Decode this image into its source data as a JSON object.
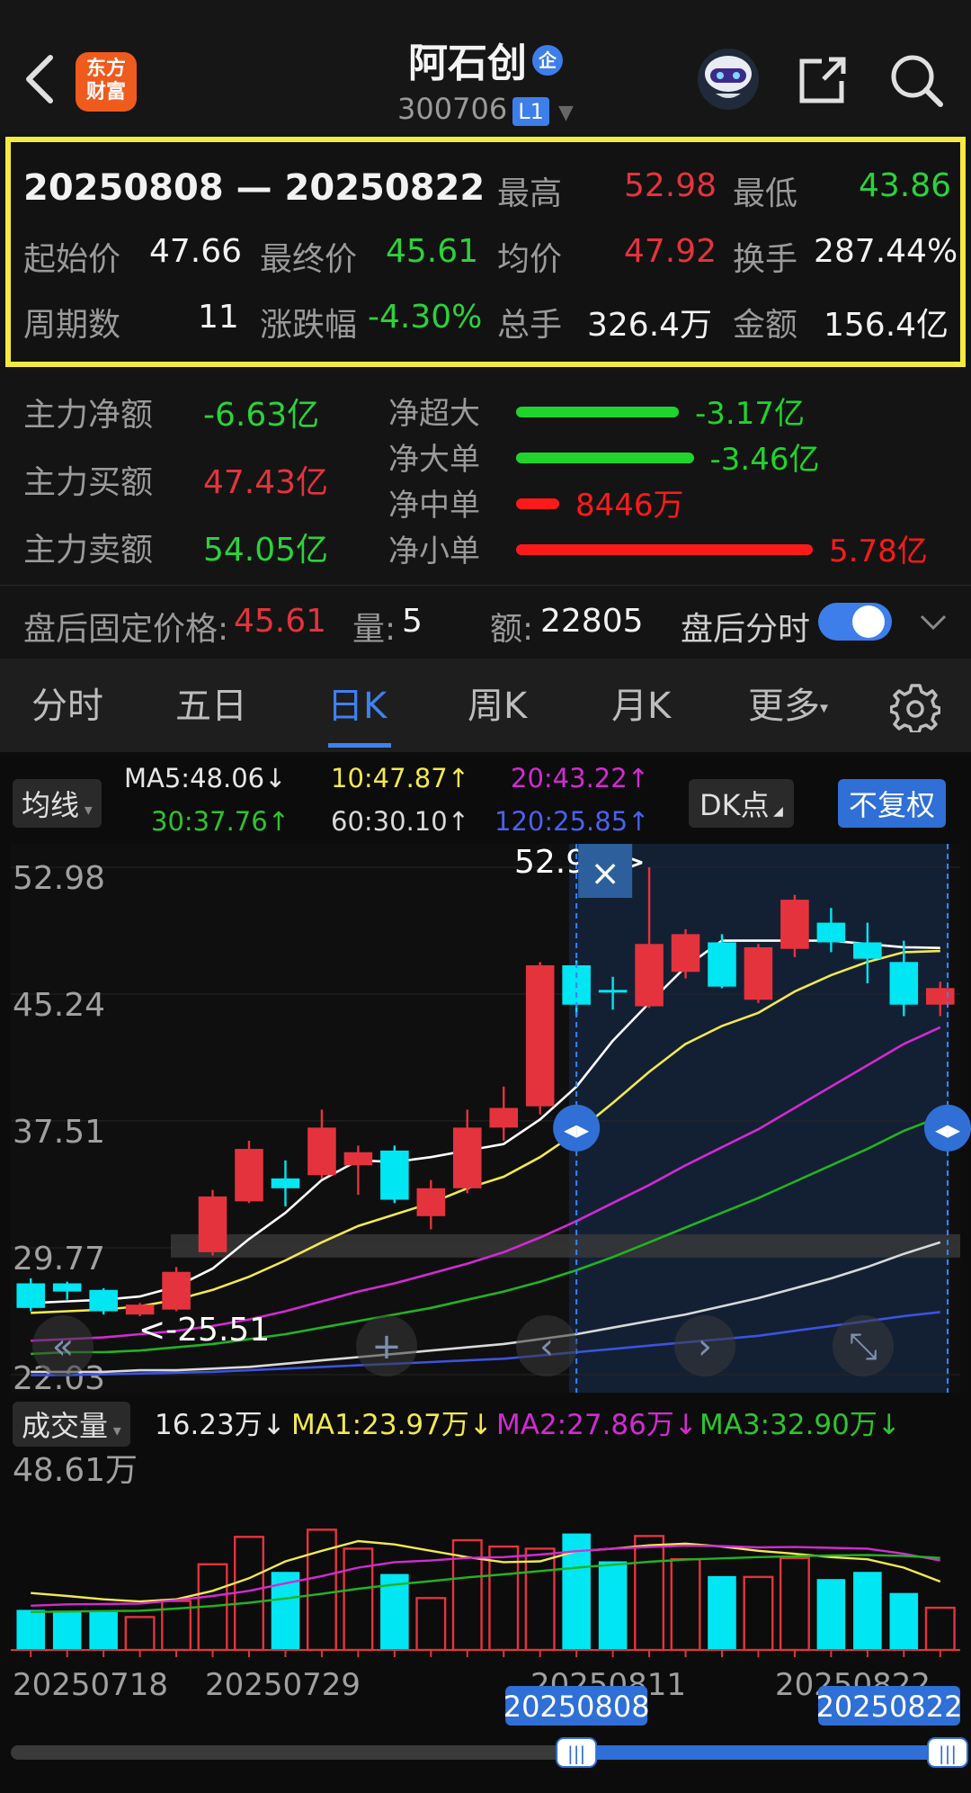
{
  "header": {
    "logo_line1": "东方",
    "logo_line2": "财富",
    "title": "阿石创",
    "title_badge": "企",
    "code": "300706",
    "level_badge": "L1"
  },
  "summary": {
    "range_start": "20250808",
    "range_sep": "—",
    "range_end": "20250822",
    "high_label": "最高",
    "high": "52.98",
    "low_label": "最低",
    "low": "43.86",
    "open_label": "起始价",
    "open": "47.66",
    "close_label": "最终价",
    "close": "45.61",
    "avg_label": "均价",
    "avg": "47.92",
    "turnover_label": "换手",
    "turnover": "287.44%",
    "periods_label": "周期数",
    "periods": "11",
    "change_label": "涨跌幅",
    "change": "-4.30%",
    "volume_label": "总手",
    "volume": "326.4万",
    "amount_label": "金额",
    "amount": "156.4亿"
  },
  "moneyflow": {
    "net_label": "主力净额",
    "net": "-6.63亿",
    "buy_label": "主力买额",
    "buy": "47.43亿",
    "sell_label": "主力卖额",
    "sell": "54.05亿",
    "rows": [
      {
        "label": "净超大",
        "value": "-3.17亿",
        "color": "#1fd42b",
        "magnitude": 3.17
      },
      {
        "label": "净大单",
        "value": "-3.46亿",
        "color": "#1fd42b",
        "magnitude": 3.46
      },
      {
        "label": "净中单",
        "value": "8446万",
        "color": "#ff1a1a",
        "magnitude": 0.84
      },
      {
        "label": "净小单",
        "value": "5.78亿",
        "color": "#ff1a1a",
        "magnitude": 5.78
      }
    ]
  },
  "afterhours": {
    "price_label": "盘后固定价格:",
    "price": "45.61",
    "qty_label": "量:",
    "qty": "5",
    "amt_label": "额:",
    "amt": "22805",
    "toggle_label": "盘后分时"
  },
  "tabs": [
    "分时",
    "五日",
    "日K",
    "周K",
    "月K",
    "更多"
  ],
  "active_tab": "日K",
  "ma_bar": {
    "select_label": "均线",
    "ma5": "MA5:48.06↓",
    "ma10": "10:47.87↑",
    "ma20": "20:43.22↑",
    "ma30": "30:37.76↑",
    "ma60": "60:30.10↑",
    "ma120": "120:25.85↑",
    "dk_label": "DK点",
    "adjust_label": "不复权",
    "colors": {
      "ma5": "#ffffff",
      "ma10": "#f2e94e",
      "ma20": "#d32ad3",
      "ma30": "#22b322",
      "ma60": "#d9d9d9",
      "ma120": "#3d52e0"
    }
  },
  "vol_bar": {
    "select_label": "成交量",
    "vol": "16.23万↓",
    "ma1": "MA1:23.97万↓",
    "ma2": "MA2:27.86万↓",
    "ma3": "MA3:32.90万↓"
  },
  "colors": {
    "up": "#e5333d",
    "down": "#00e6f2",
    "accent": "#3d82f0",
    "highlight": "#f5ea3f"
  },
  "chart_data": {
    "type": "candlestick",
    "y_ticks": [
      "52.98",
      "45.24",
      "37.51",
      "29.77",
      "22.03"
    ],
    "ylim": [
      22.03,
      52.98
    ],
    "vol_tick": "48.61万",
    "vol_max": 48.61,
    "x_labels": [
      "20250718",
      "20250729",
      "20250811",
      "20250822"
    ],
    "selected_range": [
      "20250808",
      "20250822"
    ],
    "max_marker": "52.98->",
    "min_marker": "<-25.51",
    "candles": [
      {
        "o": 27.6,
        "h": 27.9,
        "l": 25.9,
        "c": 26.1
      },
      {
        "o": 27.6,
        "h": 27.7,
        "l": 26.6,
        "c": 27.1
      },
      {
        "o": 27.2,
        "h": 27.3,
        "l": 25.7,
        "c": 25.9
      },
      {
        "o": 25.7,
        "h": 26.4,
        "l": 25.6,
        "c": 26.3
      },
      {
        "o": 26.0,
        "h": 28.6,
        "l": 25.9,
        "c": 28.3
      },
      {
        "o": 29.5,
        "h": 33.3,
        "l": 29.3,
        "c": 32.9
      },
      {
        "o": 32.6,
        "h": 36.3,
        "l": 32.5,
        "c": 35.8
      },
      {
        "o": 34.0,
        "h": 35.1,
        "l": 32.3,
        "c": 33.4
      },
      {
        "o": 34.2,
        "h": 38.2,
        "l": 34.0,
        "c": 37.1
      },
      {
        "o": 34.8,
        "h": 36.0,
        "l": 33.0,
        "c": 35.6
      },
      {
        "o": 35.7,
        "h": 36.0,
        "l": 32.5,
        "c": 32.7
      },
      {
        "o": 31.7,
        "h": 33.9,
        "l": 30.9,
        "c": 33.4
      },
      {
        "o": 33.4,
        "h": 38.2,
        "l": 33.1,
        "c": 37.1
      },
      {
        "o": 37.1,
        "h": 39.6,
        "l": 36.3,
        "c": 38.3
      },
      {
        "o": 38.4,
        "h": 47.2,
        "l": 37.9,
        "c": 47.0
      },
      {
        "o": 47.0,
        "h": 47.3,
        "l": 43.9,
        "c": 44.6
      },
      {
        "o": 45.5,
        "h": 46.3,
        "l": 44.3,
        "c": 45.4
      },
      {
        "o": 44.5,
        "h": 52.98,
        "l": 44.4,
        "c": 48.3
      },
      {
        "o": 46.6,
        "h": 49.2,
        "l": 46.2,
        "c": 48.9
      },
      {
        "o": 48.4,
        "h": 48.9,
        "l": 45.6,
        "c": 45.7
      },
      {
        "o": 44.9,
        "h": 48.3,
        "l": 44.7,
        "c": 48.1
      },
      {
        "o": 48.0,
        "h": 51.3,
        "l": 47.5,
        "c": 51.0
      },
      {
        "o": 49.6,
        "h": 50.5,
        "l": 47.8,
        "c": 48.4
      },
      {
        "o": 48.4,
        "h": 49.6,
        "l": 45.9,
        "c": 47.4
      },
      {
        "o": 47.2,
        "h": 48.5,
        "l": 43.9,
        "c": 44.6
      },
      {
        "o": 44.6,
        "h": 46.0,
        "l": 43.9,
        "c": 45.61
      }
    ],
    "ma5": [
      26.4,
      26.5,
      26.6,
      26.8,
      27.4,
      28.5,
      30.3,
      31.9,
      33.9,
      35.1,
      35.0,
      35.3,
      35.7,
      36.1,
      37.6,
      39.6,
      42.4,
      44.7,
      46.9,
      48.5,
      48.5,
      48.5,
      48.5,
      48.3,
      48.1,
      48.06
    ],
    "ma10": [
      25.8,
      25.9,
      26.0,
      26.2,
      26.6,
      27.2,
      28.0,
      29.0,
      30.1,
      31.1,
      31.8,
      32.5,
      33.4,
      34.1,
      35.3,
      36.8,
      38.6,
      40.5,
      42.2,
      43.3,
      44.1,
      45.4,
      46.4,
      47.2,
      47.8,
      47.87
    ],
    "ma20": [
      24.1,
      24.2,
      24.3,
      24.5,
      24.7,
      25.0,
      25.4,
      25.9,
      26.5,
      27.1,
      27.6,
      28.2,
      28.8,
      29.5,
      30.4,
      31.4,
      32.5,
      33.6,
      34.8,
      35.9,
      37.0,
      38.3,
      39.6,
      40.9,
      42.2,
      43.22
    ],
    "ma30": [
      23.3,
      23.4,
      23.4,
      23.5,
      23.7,
      23.9,
      24.2,
      24.5,
      24.9,
      25.3,
      25.7,
      26.1,
      26.6,
      27.1,
      27.7,
      28.4,
      29.2,
      30.1,
      31.0,
      31.9,
      32.8,
      33.8,
      34.8,
      35.8,
      36.9,
      37.76
    ],
    "ma60": [
      22.2,
      22.2,
      22.2,
      22.3,
      22.3,
      22.4,
      22.5,
      22.7,
      22.9,
      23.1,
      23.3,
      23.5,
      23.7,
      23.9,
      24.2,
      24.5,
      24.9,
      25.3,
      25.7,
      26.2,
      26.7,
      27.3,
      27.9,
      28.6,
      29.4,
      30.1
    ],
    "ma120": [
      22.0,
      22.0,
      22.05,
      22.1,
      22.15,
      22.2,
      22.3,
      22.4,
      22.5,
      22.6,
      22.7,
      22.8,
      22.9,
      23.0,
      23.2,
      23.4,
      23.6,
      23.8,
      24.0,
      24.2,
      24.4,
      24.7,
      25.0,
      25.3,
      25.6,
      25.85
    ],
    "volumes": [
      9.5,
      9.3,
      9.0,
      7.8,
      11.6,
      20.3,
      26.8,
      18.5,
      28.5,
      24.0,
      18.0,
      12.3,
      26.0,
      24.5,
      24.0,
      27.6,
      21.0,
      27.0,
      21.5,
      17.5,
      17.3,
      21.8,
      16.8,
      18.5,
      13.5,
      10.0
    ],
    "vol_ma1": [
      13.5,
      12.8,
      12.0,
      11.5,
      12.0,
      14.0,
      17.0,
      21.0,
      23.5,
      25.8,
      25.0,
      23.5,
      22.0,
      20.8,
      21.0,
      23.4,
      24.0,
      24.8,
      25.2,
      24.5,
      23.5,
      22.8,
      22.0,
      21.5,
      19.5,
      16.2
    ],
    "vol_ma2": [
      10.5,
      10.8,
      10.9,
      11.0,
      11.8,
      12.8,
      14.0,
      15.8,
      17.5,
      19.5,
      20.8,
      21.2,
      21.8,
      22.0,
      22.6,
      23.4,
      24.0,
      24.4,
      24.7,
      24.6,
      24.3,
      24.4,
      24.2,
      24.0,
      22.8,
      21.2
    ],
    "vol_ma3": [
      9.0,
      9.1,
      9.2,
      9.3,
      9.8,
      10.4,
      11.2,
      12.2,
      13.3,
      14.5,
      15.5,
      16.3,
      17.2,
      17.9,
      18.7,
      19.5,
      20.2,
      20.9,
      21.4,
      21.7,
      22.0,
      22.2,
      22.4,
      22.5,
      22.3,
      21.8
    ]
  }
}
